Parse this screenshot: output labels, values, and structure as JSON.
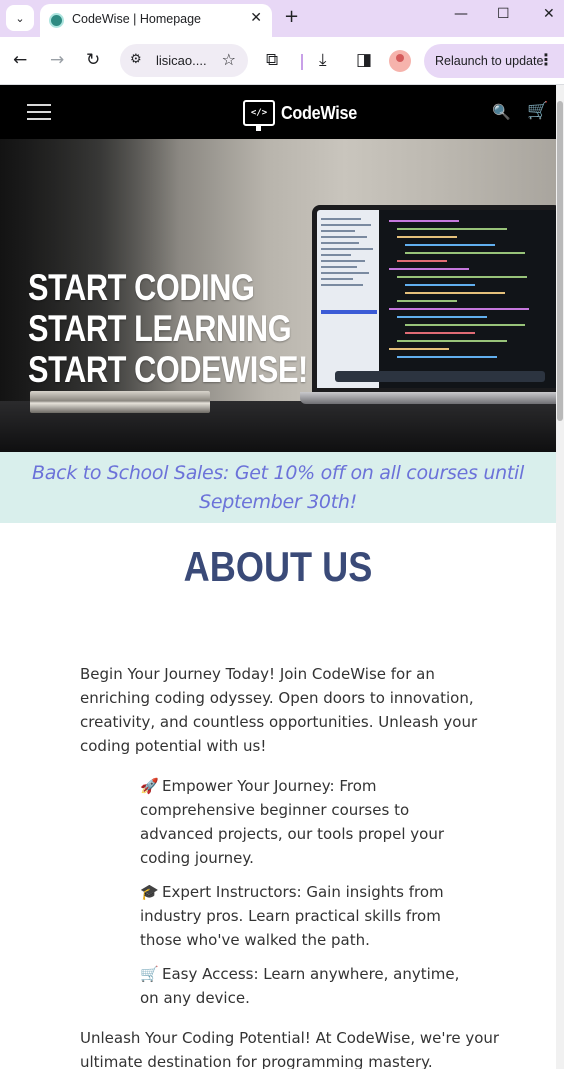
{
  "browser": {
    "tab_title": "CodeWise | Homepage",
    "url": "lisicao....",
    "relaunch_label": "Relaunch to update"
  },
  "nav": {
    "brand": "CodeWise",
    "logo_mark": "</>"
  },
  "hero": {
    "lines": [
      "START CODING",
      "START LEARNING",
      "START CODEWISE!"
    ]
  },
  "sale_banner": "Back to School Sales: Get 10% off on all courses until September 30th!",
  "about": {
    "title": "ABOUT US",
    "intro": "Begin Your Journey Today! Join CodeWise for an enriching coding odyssey. Open doors to innovation, creativity, and countless opportunities. Unleash your coding potential with us!",
    "features": [
      {
        "icon": "rocket-icon",
        "glyph": "🚀",
        "text": "Empower Your Journey: From comprehensive beginner courses to advanced projects, our tools propel your coding journey."
      },
      {
        "icon": "graduation-cap-icon",
        "glyph": "🎓",
        "text": "Expert Instructors: Gain insights from industry pros. Learn practical skills from those who've walked the path."
      },
      {
        "icon": "shopping-cart-icon",
        "glyph": "🛒",
        "text": "Easy Access: Learn anywhere, anytime, on any device."
      }
    ],
    "outro": "Unleash Your Coding Potential! At CodeWise, we're your ultimate destination for programming mastery."
  },
  "colors": {
    "tabbar": "#e8d8f6",
    "nav_bg": "#000000",
    "banner_bg": "#d9efec",
    "banner_text": "#6b72d9",
    "about_title": "#3a4a78"
  }
}
